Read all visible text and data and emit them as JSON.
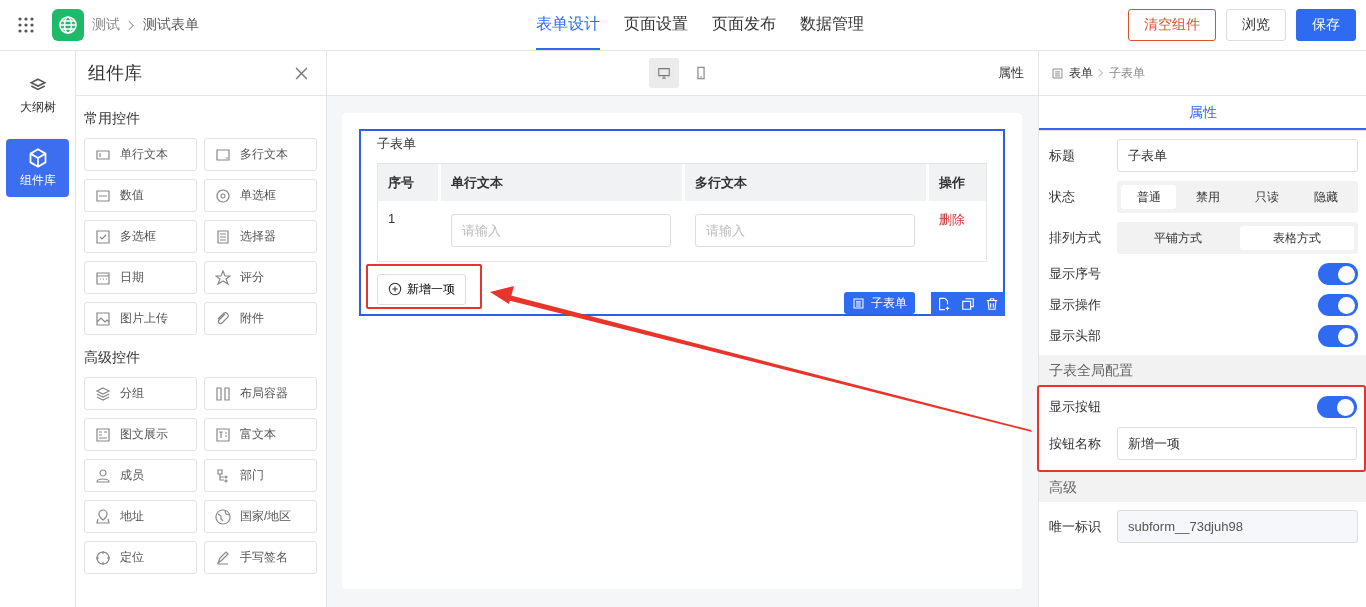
{
  "header": {
    "breadcrumb": [
      "测试",
      "测试表单"
    ],
    "nav": [
      {
        "label": "表单设计",
        "selected": true
      },
      {
        "label": "页面设置",
        "selected": false
      },
      {
        "label": "页面发布",
        "selected": false
      },
      {
        "label": "数据管理",
        "selected": false
      }
    ],
    "buttons": [
      {
        "label": "清空组件",
        "kind": "danger"
      },
      {
        "label": "浏览",
        "kind": "default"
      },
      {
        "label": "保存",
        "kind": "primary"
      }
    ]
  },
  "rail": [
    {
      "label": "大纲树",
      "selected": false
    },
    {
      "label": "组件库",
      "selected": true
    }
  ],
  "library": {
    "title": "组件库",
    "groups": [
      {
        "title": "常用控件",
        "items": [
          "单行文本",
          "多行文本",
          "数值",
          "单选框",
          "多选框",
          "选择器",
          "日期",
          "评分",
          "图片上传",
          "附件"
        ]
      },
      {
        "title": "高级控件",
        "items": [
          "分组",
          "布局容器",
          "图文展示",
          "富文本",
          "成员",
          "部门",
          "地址",
          "国家/地区",
          "定位",
          "手写签名"
        ]
      }
    ]
  },
  "canvas": {
    "devices": [
      {
        "selected": true
      },
      {
        "selected": false
      }
    ],
    "panel_label": "属性",
    "subform": {
      "title": "子表单",
      "columns": [
        "序号",
        "单行文本",
        "多行文本",
        "操作"
      ],
      "rows": [
        {
          "cells": [
            {
              "kind": "text",
              "text": "1"
            },
            {
              "kind": "input",
              "placeholder": "请输入"
            },
            {
              "kind": "input",
              "placeholder": "请输入"
            },
            {
              "kind": "link",
              "text": "删除"
            }
          ]
        }
      ],
      "add_button": {
        "label": "新增一项",
        "highlighted": true
      },
      "tag": "子表单"
    }
  },
  "props": {
    "breadcrumb": [
      "表单",
      "子表单"
    ],
    "tabs": [
      {
        "label": "属性",
        "selected": true
      }
    ],
    "sections": [
      {
        "highlighted": false,
        "rows": [
          {
            "kind": "input",
            "label": "标题",
            "value": "子表单",
            "disabled": false
          },
          {
            "kind": "segmented",
            "label": "状态",
            "options": [
              {
                "label": "普通",
                "selected": true
              },
              {
                "label": "禁用",
                "selected": false
              },
              {
                "label": "只读",
                "selected": false
              },
              {
                "label": "隐藏",
                "selected": false
              }
            ]
          },
          {
            "kind": "segmented",
            "label": "排列方式",
            "options": [
              {
                "label": "平铺方式",
                "selected": false
              },
              {
                "label": "表格方式",
                "selected": true
              }
            ]
          },
          {
            "kind": "switch",
            "label": "显示序号",
            "on": true
          },
          {
            "kind": "switch",
            "label": "显示操作",
            "on": true
          },
          {
            "kind": "switch",
            "label": "显示头部",
            "on": true
          }
        ]
      },
      {
        "title": "子表全局配置",
        "highlighted": true,
        "rows": [
          {
            "kind": "switch",
            "label": "显示按钮",
            "on": true
          },
          {
            "kind": "input",
            "label": "按钮名称",
            "value": "新增一项",
            "disabled": false
          }
        ]
      },
      {
        "title": "高级",
        "highlighted": false,
        "rows": [
          {
            "kind": "input",
            "label": "唯一标识",
            "value": "subform__73djuh98",
            "disabled": true
          }
        ]
      }
    ]
  }
}
